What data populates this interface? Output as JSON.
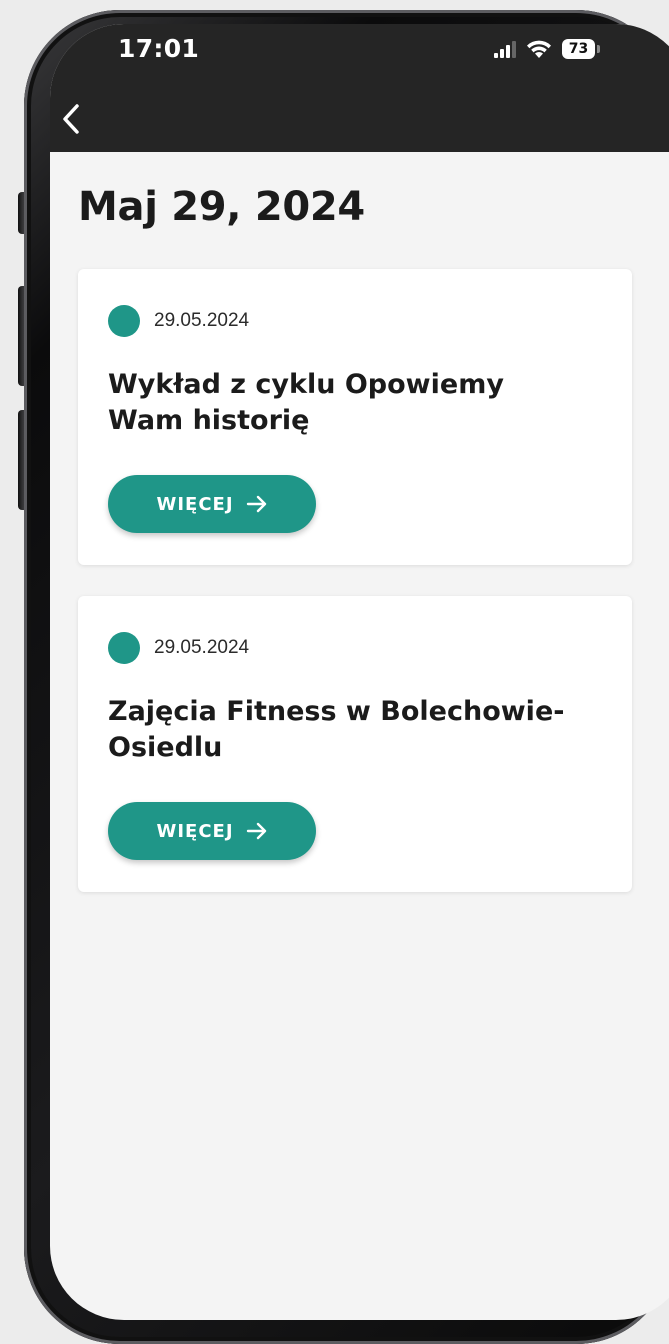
{
  "status_bar": {
    "time": "17:01",
    "battery": "73"
  },
  "header": {
    "back_icon": "chevron-left-icon"
  },
  "page": {
    "title": "Maj 29, 2024"
  },
  "events": [
    {
      "date": "29.05.2024",
      "title": "Wykład z cyklu Opowiemy Wam historię",
      "button_label": "WIĘCEJ"
    },
    {
      "date": "29.05.2024",
      "title": "Zajęcia Fitness w Bolechowie-Osiedlu",
      "button_label": "WIĘCEJ"
    }
  ],
  "colors": {
    "accent": "#1f9688",
    "header_bg": "#252525",
    "screen_bg": "#f4f4f4"
  }
}
